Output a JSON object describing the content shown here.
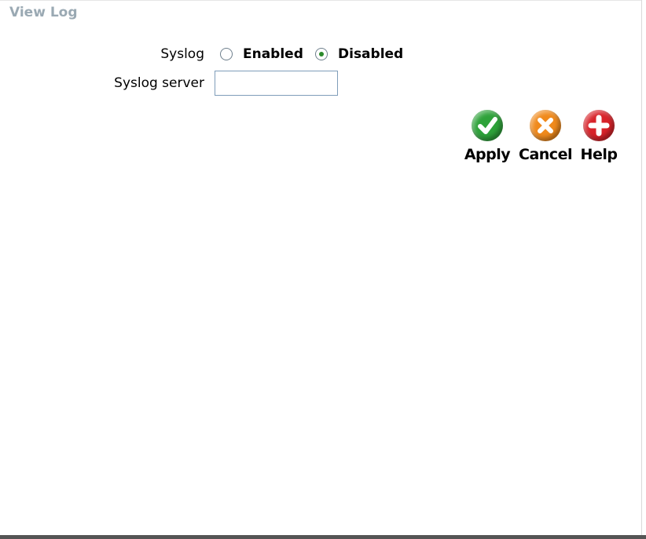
{
  "page": {
    "title": "View Log"
  },
  "syslog": {
    "label": "Syslog",
    "options": [
      {
        "label": "Enabled",
        "checked": false
      },
      {
        "label": "Disabled",
        "checked": true
      }
    ]
  },
  "syslog_server": {
    "label": "Syslog server",
    "value": ""
  },
  "actions": {
    "apply": {
      "label": "Apply",
      "color": "#2ea23a"
    },
    "cancel": {
      "label": "Cancel",
      "color": "#f08a1c"
    },
    "help": {
      "label": "Help",
      "color": "#d8232a"
    }
  }
}
